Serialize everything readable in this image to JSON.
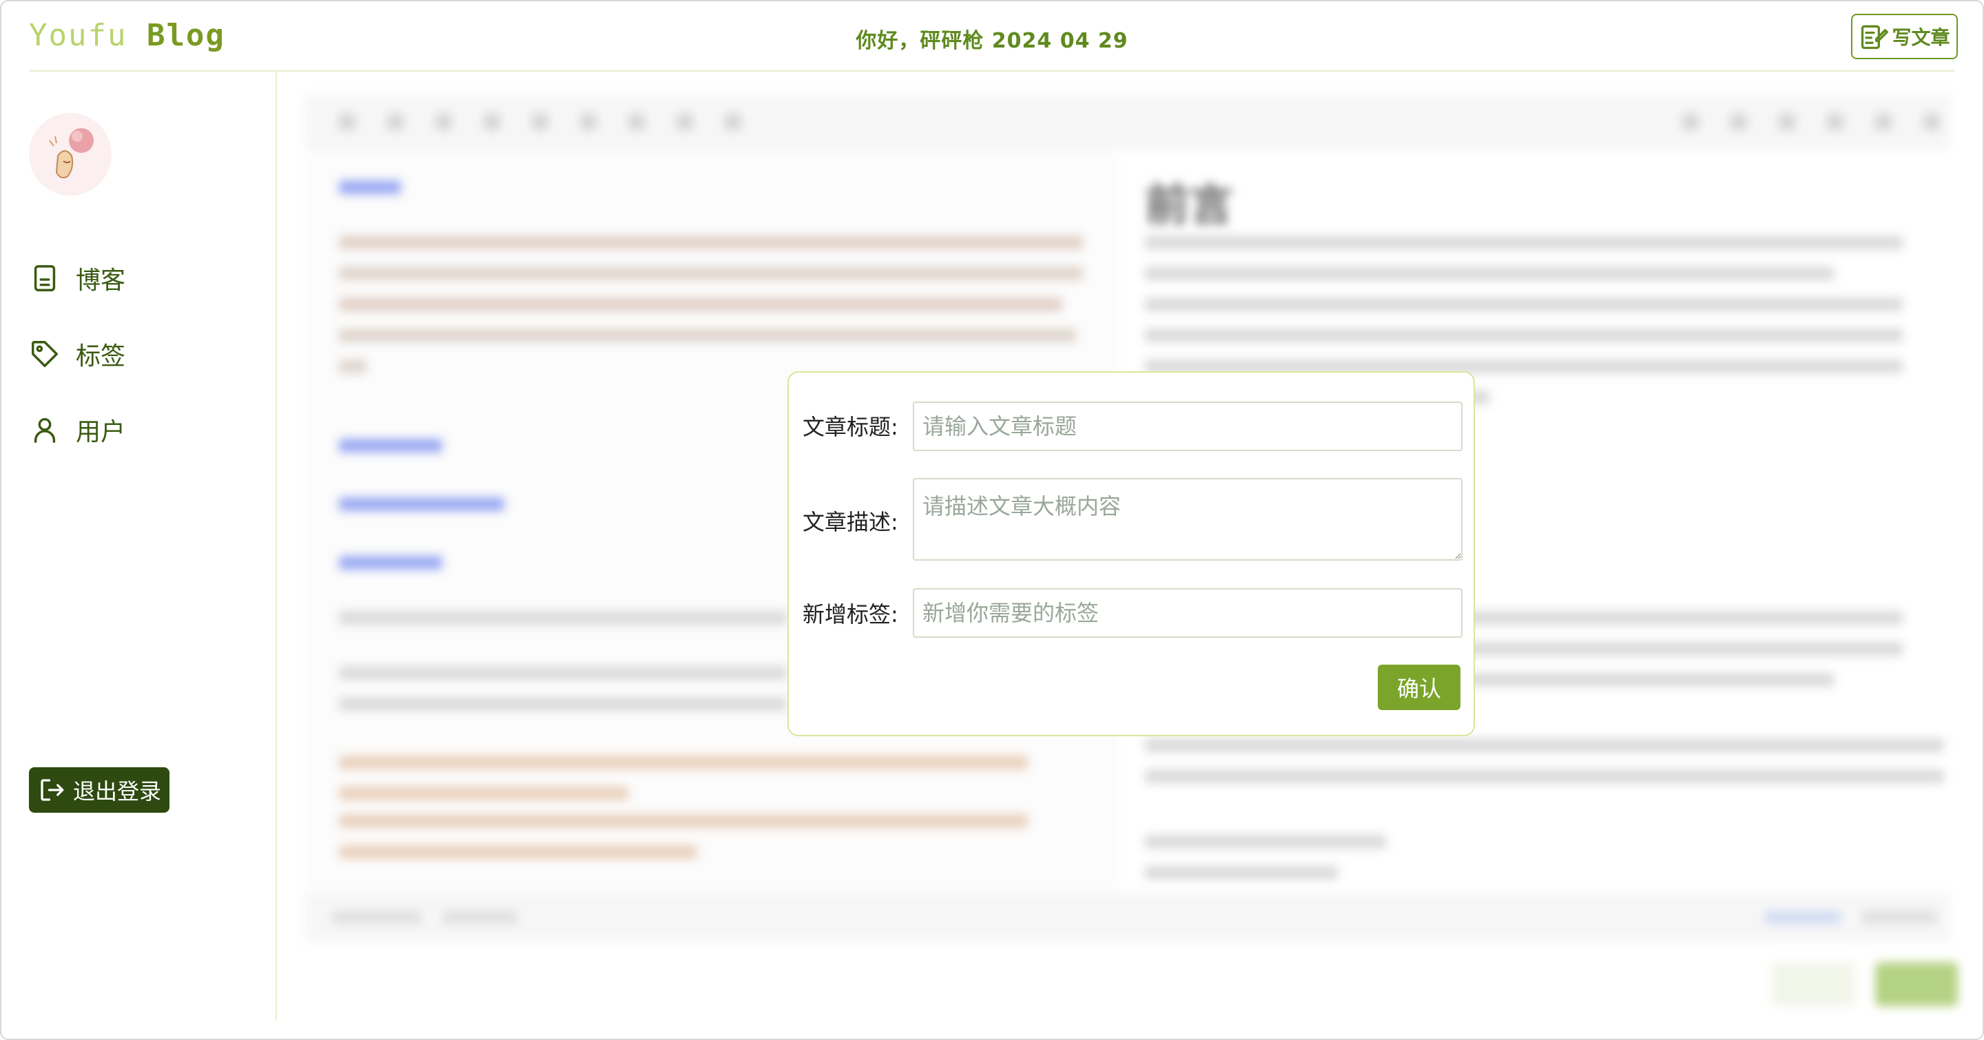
{
  "header": {
    "logo_part1": "Youfu",
    "logo_part2": "Blog",
    "greeting": "你好，砰砰枪 2024 04 29",
    "write_button_label": "写文章"
  },
  "sidebar": {
    "items": [
      {
        "label": "博客",
        "icon": "document-icon"
      },
      {
        "label": "标签",
        "icon": "tag-icon"
      },
      {
        "label": "用户",
        "icon": "user-icon"
      }
    ],
    "logout_label": "退出登录"
  },
  "modal": {
    "title_label": "文章标题:",
    "title_placeholder": "请输入文章标题",
    "desc_label": "文章描述:",
    "desc_placeholder": "请描述文章大概内容",
    "tags_label": "新增标签:",
    "tags_placeholder": "新增你需要的标签",
    "confirm_label": "确认"
  },
  "editor_preview": {
    "heading": "前言"
  },
  "colors": {
    "brand": "#6e9a20",
    "brand_dark": "#2e4a10",
    "confirm": "#7aa52a",
    "modal_border": "#d7e79a"
  }
}
